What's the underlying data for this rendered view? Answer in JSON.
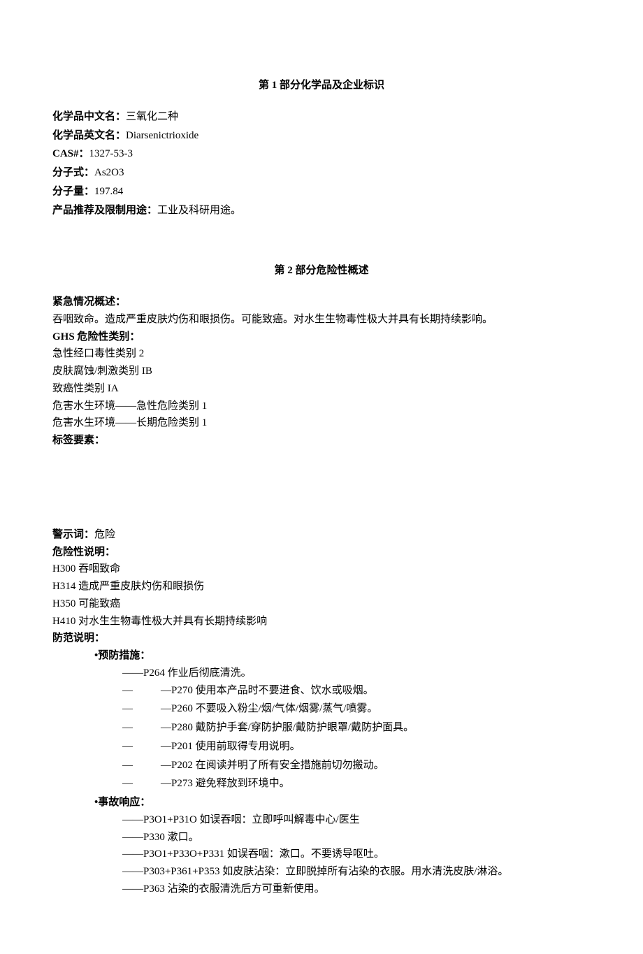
{
  "section1": {
    "title": "第 1 部分化学品及企业标识",
    "fields": {
      "cn_name_label": "化学品中文名：",
      "cn_name_value": "三氧化二种",
      "en_name_label": "化学品英文名：",
      "en_name_value": "Diarsenictrioxide",
      "cas_label": "CAS#：",
      "cas_value": "1327-53-3",
      "formula_label": "分子式：",
      "formula_value": "As2O3",
      "mw_label": "分子量：",
      "mw_value": "197.84",
      "usage_label": "产品推荐及限制用途：",
      "usage_value": "工业及科研用途。"
    }
  },
  "section2": {
    "title": "第 2 部分危险性概述",
    "emergency_label": "紧急情况概述：",
    "emergency_text": "吞咽致命。造成严重皮肤灼伤和眼损伤。可能致癌。对水生生物毒性极大并具有长期持续影响。",
    "ghs_label": "GHS 危险性类别：",
    "ghs_items": [
      "急性经口毒性类别 2",
      "皮肤腐蚀/刺激类别 IB",
      "致癌性类别 IA",
      "危害水生环境——急性危险类别 1",
      "危害水生环境——长期危险类别 1"
    ],
    "label_elements_label": "标签要素：",
    "signal_word_label": "警示词：",
    "signal_word_value": "危险",
    "hazard_statement_label": "危险性说明：",
    "hazard_statements": [
      "H300 吞咽致命",
      "H314 造成严重皮肤灼伤和眼损伤",
      "H350 可能致癌",
      "H410 对水生生物毒性极大并具有长期持续影响"
    ],
    "precaution_label": "防范说明：",
    "prevention_label": "•预防措施：",
    "prevention_first": "——P264 作业后彻底清洗。",
    "prevention_items": [
      "—P270 使用本产品时不要进食、饮水或吸烟。",
      "—P260 不要吸入粉尘/烟/气体/烟雾/蒸气/喷雾。",
      "—P280 戴防护手套/穿防护服/戴防护眼罩/戴防护面具。",
      "—P201 使用前取得专用说明。",
      "—P202 在阅读并明了所有安全措施前切勿搬动。",
      "—P273 避免释放到环境中。"
    ],
    "response_label": "•事故响应：",
    "response_items": [
      "——P3O1+P31O 如误吞咽：立即呼叫解毒中心/医生",
      "——P330 漱口。",
      "——P3O1+P33O+P331 如误吞咽：漱口。不要诱导呕吐。",
      "——P303+P361+P353 如皮肤沾染：立即脱掉所有沾染的衣服。用水清洗皮肤/淋浴。",
      "——P363 沾染的衣服清洗后方可重新使用。"
    ]
  },
  "dash": "—"
}
